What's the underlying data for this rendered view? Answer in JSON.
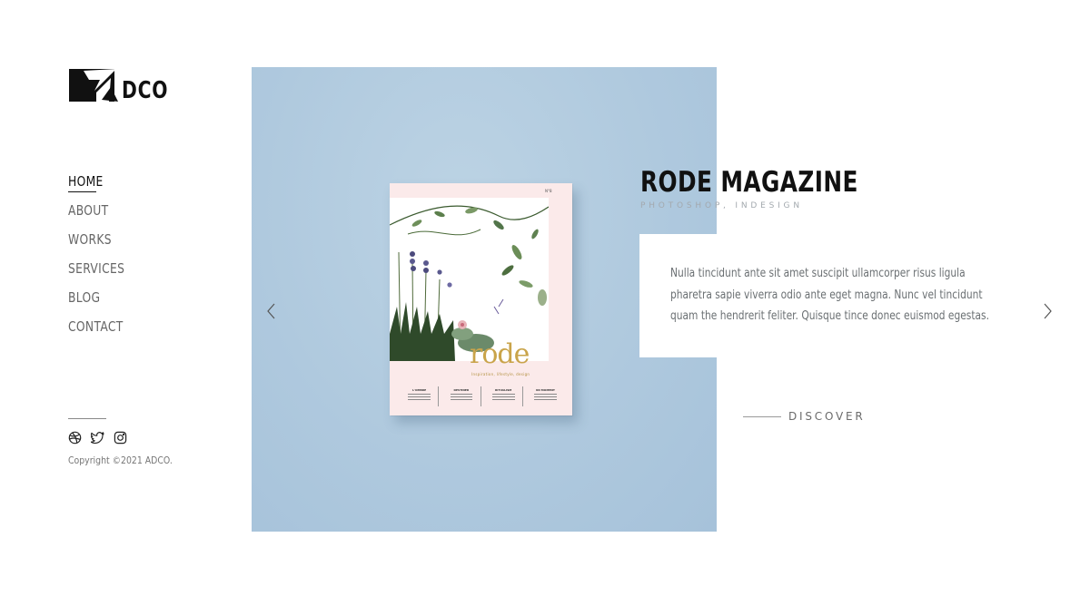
{
  "brand": {
    "logo_text": "DCO",
    "logo_letter": "A"
  },
  "nav": {
    "items": [
      {
        "label": "HOME",
        "active": true
      },
      {
        "label": "ABOUT",
        "active": false
      },
      {
        "label": "WORKS",
        "active": false
      },
      {
        "label": "SERVICES",
        "active": false
      },
      {
        "label": "BLOG",
        "active": false
      },
      {
        "label": "CONTACT",
        "active": false
      }
    ]
  },
  "social": {
    "icons": [
      "dribbble-icon",
      "twitter-icon",
      "instagram-icon"
    ]
  },
  "footer": {
    "copyright": "Copyright ©2021 ADCO."
  },
  "slide": {
    "title": "RODE MAGAZINE",
    "categories": "PHOTOSHOP, INDESIGN",
    "description": "Nulla tincidunt ante sit amet suscipit ullamcorper risus ligula pharetra sapie viverra odio ante eget magna. Nunc vel tincidunt quam the hendrerit feliter. Quisque tince donec euismod egestas.",
    "cta": "DISCOVER",
    "image": {
      "magazine_title": "rode",
      "magazine_subtitle": "Inspiration, lifestyle, design",
      "sections": [
        "L'OMBRE",
        "DESTINER",
        "RITUALISM",
        "UN MOMENT"
      ],
      "issue": "N°8"
    }
  },
  "colors": {
    "hero_bg": "#b2cce0",
    "text_dark": "#111111",
    "text_muted": "#6a6f72",
    "accent_gold": "#c9a44a"
  }
}
